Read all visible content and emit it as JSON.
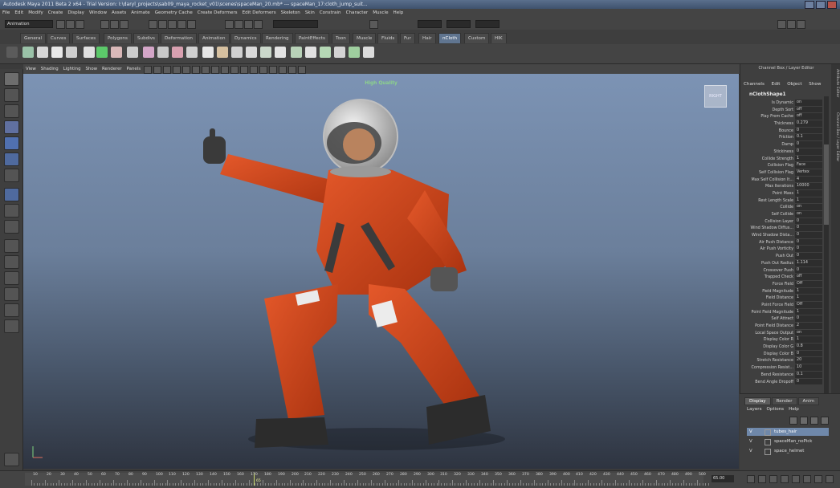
{
  "window": {
    "title": "Autodesk Maya 2011 Beta 2 x64 - Trial Version: I:\\daryl_projects\\sab09_maya_rocket_v01\\scenes\\spaceMan_20.mb* --- spaceMan_17:cloth_jump_suit..."
  },
  "menubar": [
    "File",
    "Edit",
    "Modify",
    "Create",
    "Display",
    "Window",
    "Assets",
    "Animate",
    "Geometry Cache",
    "Create Deformers",
    "Edit Deformers",
    "Skeleton",
    "Skin",
    "Constrain",
    "Character",
    "Muscle",
    "Help"
  ],
  "status_line": {
    "menu_set": "Animation"
  },
  "shelf_tabs": [
    "General",
    "Curves",
    "Surfaces",
    "Polygons",
    "Subdivs",
    "Deformation",
    "Animation",
    "Dynamics",
    "Rendering",
    "PaintEffects",
    "Toon",
    "Muscle",
    "Fluids",
    "Fur",
    "Hair",
    "nCloth",
    "Custom",
    "HIK"
  ],
  "shelf_tabs_active": "nCloth",
  "panel": {
    "menus": [
      "View",
      "Shading",
      "Lighting",
      "Show",
      "Renderer",
      "Panels"
    ],
    "hud_label": "High Quality",
    "viewcube_label": "RIGHT"
  },
  "colors": {
    "accent": "#607590",
    "hud_green": "#8cd18c",
    "layer_selected": "#6f88aa"
  },
  "channel_box": {
    "title": "Channel Box / Layer Editor",
    "menus": [
      "Channels",
      "Edit",
      "Object",
      "Show"
    ],
    "node": "nClothShape1",
    "attributes": [
      {
        "label": "Is Dynamic",
        "value": "on"
      },
      {
        "label": "Depth Sort",
        "value": "off"
      },
      {
        "label": "Play From Cache",
        "value": "off"
      },
      {
        "label": "Thickness",
        "value": "0.279"
      },
      {
        "label": "Bounce",
        "value": "0"
      },
      {
        "label": "Friction",
        "value": "0.1"
      },
      {
        "label": "Damp",
        "value": "0"
      },
      {
        "label": "Stickiness",
        "value": "0"
      },
      {
        "label": "Collide Strength",
        "value": "1"
      },
      {
        "label": "Collision Flag",
        "value": "Face"
      },
      {
        "label": "Self Collision Flag",
        "value": "Vertex"
      },
      {
        "label": "Max Self Collision It...",
        "value": "4"
      },
      {
        "label": "Max Iterations",
        "value": "10000"
      },
      {
        "label": "Point Mass",
        "value": "1"
      },
      {
        "label": "Rest Length Scale",
        "value": "1"
      },
      {
        "label": "Collide",
        "value": "on"
      },
      {
        "label": "Self Collide",
        "value": "on"
      },
      {
        "label": "Collision Layer",
        "value": "0"
      },
      {
        "label": "Wind Shadow Diffus...",
        "value": "0"
      },
      {
        "label": "Wind Shadow Dista...",
        "value": "0"
      },
      {
        "label": "Air Push Distance",
        "value": "0"
      },
      {
        "label": "Air Push Vorticity",
        "value": "0"
      },
      {
        "label": "Push Out",
        "value": "0"
      },
      {
        "label": "Push Out Radius",
        "value": "1.114"
      },
      {
        "label": "Crossover Push",
        "value": "0"
      },
      {
        "label": "Trapped Check",
        "value": "off"
      },
      {
        "label": "Force Field",
        "value": "Off"
      },
      {
        "label": "Field Magnitude",
        "value": "1"
      },
      {
        "label": "Field Distance",
        "value": "1"
      },
      {
        "label": "Point Force Field",
        "value": "Off"
      },
      {
        "label": "Point Field Magnitude",
        "value": "1"
      },
      {
        "label": "Self Attract",
        "value": "0"
      },
      {
        "label": "Point Field Distance",
        "value": "2"
      },
      {
        "label": "Local Space Output",
        "value": "on"
      },
      {
        "label": "Display Color R",
        "value": "1"
      },
      {
        "label": "Display Color G",
        "value": "0.8"
      },
      {
        "label": "Display Color B",
        "value": "0"
      },
      {
        "label": "Stretch Resistance",
        "value": "20"
      },
      {
        "label": "Compression Resist...",
        "value": "10"
      },
      {
        "label": "Bend Resistance",
        "value": "0.1"
      },
      {
        "label": "Bend Angle Dropoff",
        "value": "0"
      }
    ]
  },
  "side_tabs": [
    "Attribute Editor",
    "Channel Box / Layer Editor"
  ],
  "layer_editor": {
    "tabs": [
      "Display",
      "Render",
      "Anim"
    ],
    "active_tab": "Display",
    "menus": [
      "Layers",
      "Options",
      "Help"
    ],
    "layers": [
      {
        "visible": "V",
        "name": "tubes_hair",
        "selected": true
      },
      {
        "visible": "V",
        "name": "spaceMan_noPick",
        "selected": false
      },
      {
        "visible": "V",
        "name": "space_helmet",
        "selected": false
      }
    ]
  },
  "time_slider": {
    "tick_labels": [
      "10",
      "20",
      "30",
      "40",
      "50",
      "60",
      "70",
      "80",
      "90",
      "100",
      "110",
      "120",
      "130",
      "140",
      "150",
      "160",
      "170",
      "180",
      "190",
      "200",
      "210",
      "220",
      "230",
      "240",
      "250",
      "260",
      "270",
      "280",
      "290",
      "300",
      "310",
      "320",
      "330",
      "340",
      "350",
      "360",
      "370",
      "380",
      "390",
      "400",
      "410",
      "420",
      "430",
      "440",
      "450",
      "460",
      "470",
      "480",
      "490",
      "500"
    ],
    "current_frame": "65.00",
    "cursor_label": "65"
  }
}
